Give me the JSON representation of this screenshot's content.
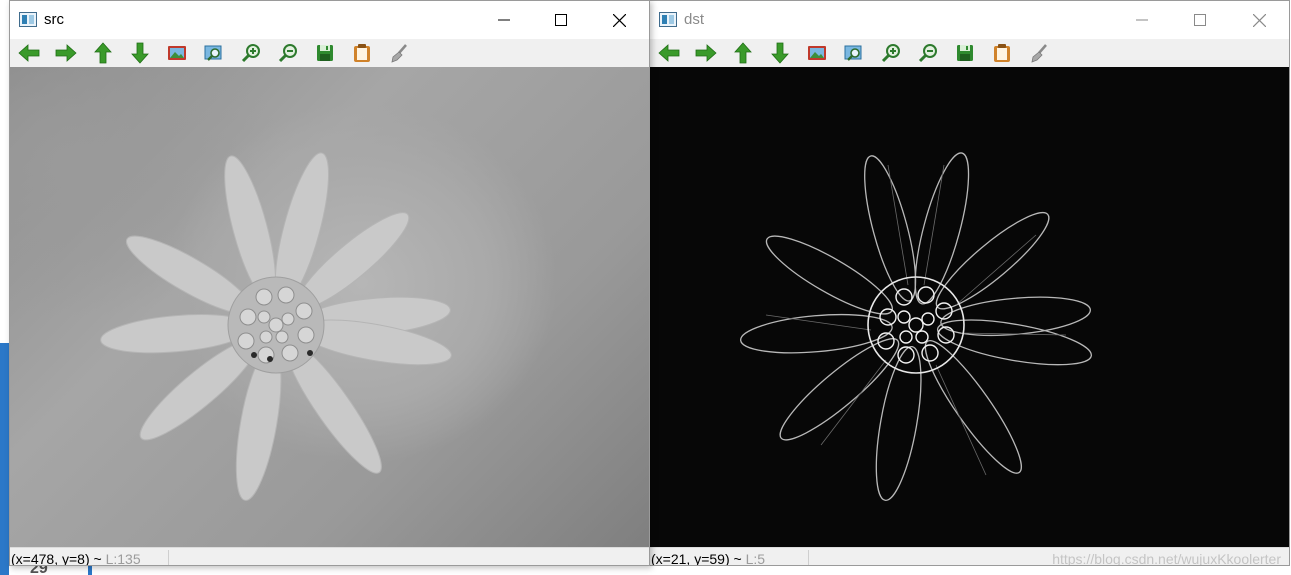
{
  "desktop": {
    "bottom_number": "29"
  },
  "windows": [
    {
      "id": "src",
      "title": "src",
      "toolbar": [
        "pan-left",
        "pan-right",
        "pan-up",
        "pan-down",
        "zoom-original",
        "zoom-fit",
        "zoom-in",
        "zoom-out",
        "save",
        "copy",
        "properties"
      ],
      "status": {
        "coords": "(x=478, y=8)",
        "sep": "~",
        "intensity": "L:135"
      }
    },
    {
      "id": "dst",
      "title": "dst",
      "toolbar": [
        "pan-left",
        "pan-right",
        "pan-up",
        "pan-down",
        "zoom-original",
        "zoom-fit",
        "zoom-in",
        "zoom-out",
        "save",
        "copy",
        "properties"
      ],
      "status": {
        "coords": "(x=21, y=59)",
        "sep": "~",
        "intensity": "L:5"
      },
      "watermark": "https://blog.csdn.net/wujuxKkoolerter"
    }
  ],
  "colors": {
    "arrow_green": "#3a9a2a",
    "save_green": "#2f8a2f",
    "copy_orange": "#d0822a",
    "edge_white": "#e8e8e8"
  }
}
